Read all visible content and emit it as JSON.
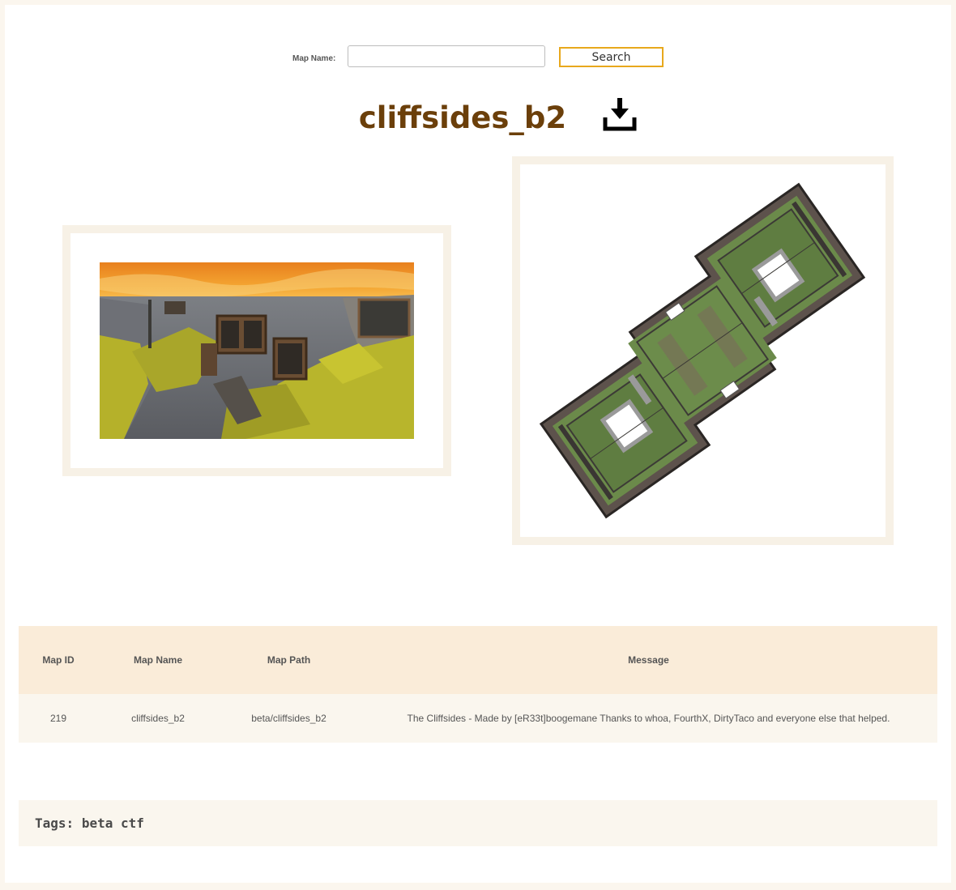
{
  "search": {
    "label": "Map Name:",
    "value": "",
    "placeholder": "",
    "button_label": "Search"
  },
  "map": {
    "title": "cliffsides_b2",
    "download_icon": "download-icon"
  },
  "images": {
    "screenshot": "map-screenshot",
    "overview": "map-overview"
  },
  "table": {
    "headers": [
      "Map ID",
      "Map Name",
      "Map Path",
      "Message"
    ],
    "row": {
      "id": "219",
      "name": "cliffsides_b2",
      "path": "beta/cliffsides_b2",
      "message": "The Cliffsides - Made by [eR33t]boogemane Thanks to whoa, FourthX, DirtyTaco and everyone else that helped."
    }
  },
  "tags": {
    "prefix": "Tags:",
    "text": "beta ctf"
  },
  "colors": {
    "title": "#6b3f0a",
    "button_border": "#e8a81c",
    "table_header_bg": "#faecd9",
    "row_bg": "#faf6ee",
    "frame_border": "#f7f1e6"
  }
}
